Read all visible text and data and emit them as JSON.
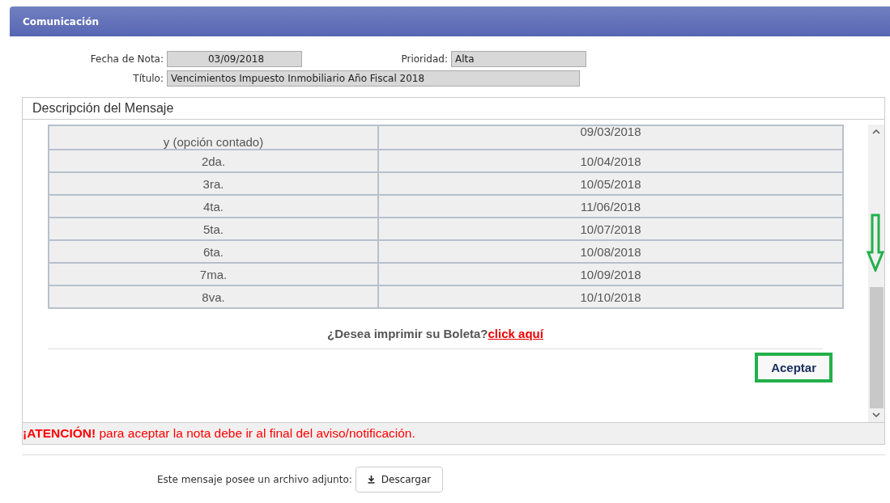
{
  "header": {
    "title": "Comunicación"
  },
  "form": {
    "fecha_label": "Fecha de Nota:",
    "fecha_value": "03/09/2018",
    "prioridad_label": "Prioridad:",
    "prioridad_value": "Alta",
    "titulo_label": "Título:",
    "titulo_value": "Vencimientos Impuesto Inmobiliario Año Fiscal 2018"
  },
  "panel": {
    "title": "Descripción del Mensaje",
    "table_rows": [
      {
        "cells": [
          "y (opción contado)",
          "09/03/2018"
        ]
      },
      {
        "cells": [
          "2da.",
          "10/04/2018"
        ]
      },
      {
        "cells": [
          "3ra.",
          "10/05/2018"
        ]
      },
      {
        "cells": [
          "4ta.",
          "11/06/2018"
        ]
      },
      {
        "cells": [
          "5ta.",
          "10/07/2018"
        ]
      },
      {
        "cells": [
          "6ta.",
          "10/08/2018"
        ]
      },
      {
        "cells": [
          "7ma.",
          "10/09/2018"
        ]
      },
      {
        "cells": [
          "8va.",
          "10/10/2018"
        ]
      }
    ],
    "print_prompt": "¿Desea imprimir su Boleta?",
    "print_link": "click aquí",
    "accept_button": {
      "label": "Aceptar",
      "highlighted": true
    },
    "warning": "**¡ATENCIÓN!** para aceptar la nota debe ir al final del aviso/notificación."
  },
  "footer": {
    "attachment_label": "Este mensaje posee un archivo adjunto:",
    "download_button": "Descargar"
  }
}
